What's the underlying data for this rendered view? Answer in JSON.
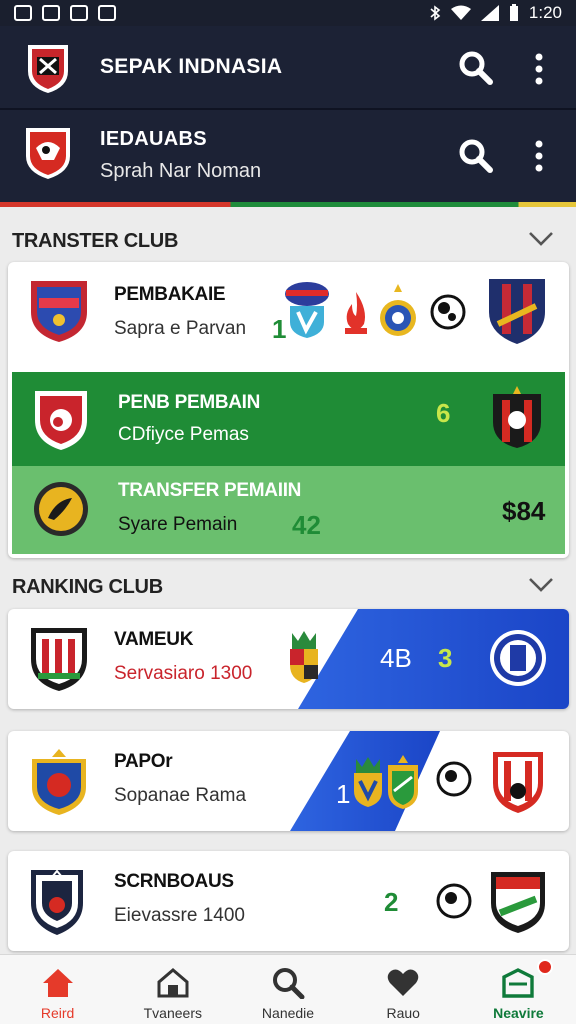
{
  "status_bar": {
    "time": "1:20"
  },
  "header": {
    "title": "SEPAK INDNASIA"
  },
  "club_header": {
    "title": "IEDAUABS",
    "subtitle": "Sprah Nar Noman"
  },
  "transfer_section": {
    "title": "TRANSTER CLUB",
    "rows": [
      {
        "name": "PEMBAKAIE",
        "sub": "Sapra e Parvan",
        "count": "1"
      },
      {
        "name": "PENB PEMBAIN",
        "sub": "CDfiyce Pemas",
        "count": "6"
      },
      {
        "name": "TRANSFER PEMAIIN",
        "sub": "Syare Pemain",
        "count": "42",
        "price": "$84"
      }
    ]
  },
  "ranking_section": {
    "title": "RANKING CLUB",
    "cards": [
      {
        "name": "VAMEUK",
        "sub": "Servasiaro 1300",
        "left": "4B",
        "right": "3"
      },
      {
        "name": "PAPOr",
        "sub": "Sopanae Rama",
        "left": "1"
      },
      {
        "name": "SCRNBOAUS",
        "sub": "Eievassre 1400",
        "left": "2"
      }
    ]
  },
  "bottom_nav": {
    "items": [
      {
        "label": "Reird"
      },
      {
        "label": "Tvaneers"
      },
      {
        "label": "Nanedie"
      },
      {
        "label": "Rauo"
      },
      {
        "label": "Neavire"
      }
    ]
  },
  "colors": {
    "accent": "#e53a2a",
    "green": "#1f8c36",
    "blue": "#2e64e0",
    "navy": "#1c2235"
  }
}
